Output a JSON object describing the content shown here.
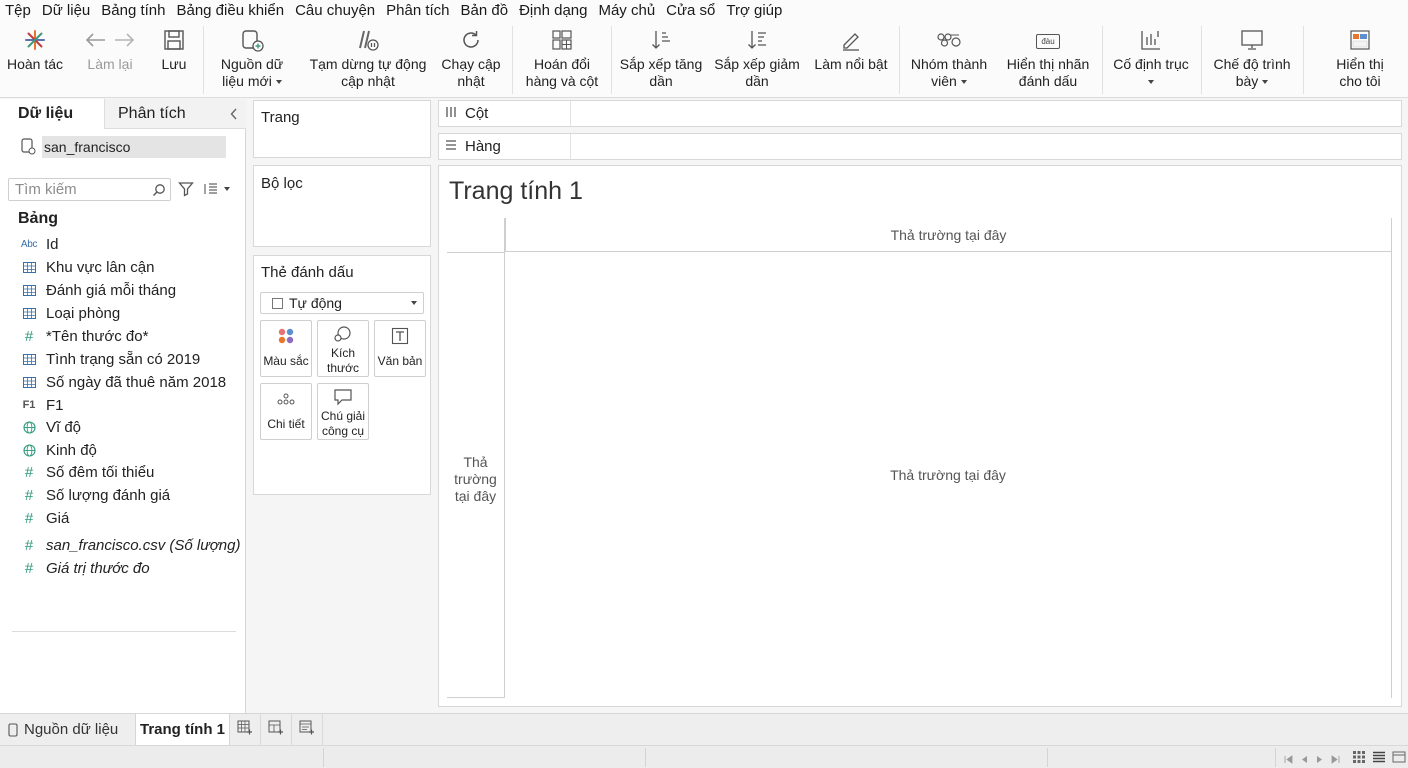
{
  "menu": [
    "Tệp",
    "Dữ liệu",
    "Bảng tính",
    "Bảng điều khiển",
    "Câu chuyện",
    "Phân tích",
    "Bản đồ",
    "Định dạng",
    "Máy chủ",
    "Cửa sổ",
    "Trợ giúp"
  ],
  "toolbar": {
    "home": "Hoàn tác",
    "redo": "Làm lại",
    "save": "Lưu",
    "new_datasource_l1": "Nguồn dữ",
    "new_datasource_l2": "liệu mới",
    "pause_update_l1": "Tạm dừng tự động",
    "pause_update_l2": "cập nhật",
    "run_update_l1": "Chạy cập",
    "run_update_l2": "nhật",
    "swap_l1": "Hoán đổi",
    "swap_l2": "hàng và cột",
    "sort_asc_l1": "Sắp xếp tăng",
    "sort_asc_l2": "dần",
    "sort_desc_l1": "Sắp xếp giảm",
    "sort_desc_l2": "dần",
    "highlight": "Làm nổi bật",
    "group_l1": "Nhóm thành",
    "group_l2": "viên",
    "labels_l1": "Hiển thị nhãn",
    "labels_l2": "đánh dấu",
    "labels_icon_text": "đàu",
    "fix_axes": "Cố định trục",
    "presentation_l1": "Chế độ trình",
    "presentation_l2": "bày",
    "show_me_l1": "Hiển thị",
    "show_me_l2": "cho tôi"
  },
  "left_pane": {
    "tab_data": "Dữ liệu",
    "tab_analysis": "Phân tích",
    "datasource": "san_francisco",
    "search_placeholder": "Tìm kiếm",
    "tables_heading": "Bảng",
    "fields": [
      {
        "icon": "Abc",
        "name": "Id"
      },
      {
        "icon": "table",
        "name": "Khu vực lân cận"
      },
      {
        "icon": "table",
        "name": "Đánh giá mỗi tháng"
      },
      {
        "icon": "table",
        "name": "Loại phòng"
      },
      {
        "icon": "#",
        "name": "*Tên thước đo*"
      },
      {
        "icon": "table",
        "name": "Tình trạng sẵn có 2019"
      },
      {
        "icon": "table",
        "name": "Số ngày đã thuê năm 2018"
      },
      {
        "icon": "F1",
        "name": "F1"
      },
      {
        "icon": "globe",
        "name": "Vĩ độ"
      },
      {
        "icon": "globe",
        "name": "Kinh độ"
      },
      {
        "icon": "#",
        "name": "Số đêm tối thiểu"
      },
      {
        "icon": "#",
        "name": "Số lượng đánh giá"
      },
      {
        "icon": "#",
        "name": "Giá"
      }
    ],
    "measures": [
      {
        "icon": "#",
        "name": "san_francisco.csv (Số lượng)"
      },
      {
        "icon": "#",
        "name": "Giá trị thước đo"
      }
    ]
  },
  "shelves": {
    "pages": "Trang",
    "filters": "Bộ lọc",
    "marks": "Thẻ đánh dấu",
    "marks_type": "Tự động",
    "mark_color": "Màu sắc",
    "mark_size_l1": "Kích",
    "mark_size_l2": "thước",
    "mark_text": "Văn bản",
    "mark_detail": "Chi tiết",
    "mark_tooltip_l1": "Chú giải",
    "mark_tooltip_l2": "công cụ",
    "columns": "Cột",
    "rows": "Hàng"
  },
  "canvas": {
    "title": "Trang tính 1",
    "drop_field": "Thả trường tại đây",
    "drop_row_l1": "Thả",
    "drop_row_l2": "trường",
    "drop_row_l3": "tại đây"
  },
  "bottom_tabs": {
    "datasource": "Nguồn dữ liệu",
    "sheet1": "Trang tính 1"
  },
  "colors": {
    "accent": "#e8762c",
    "field_green": "#2f9a7d",
    "dim_text": "#9a9a9a"
  }
}
